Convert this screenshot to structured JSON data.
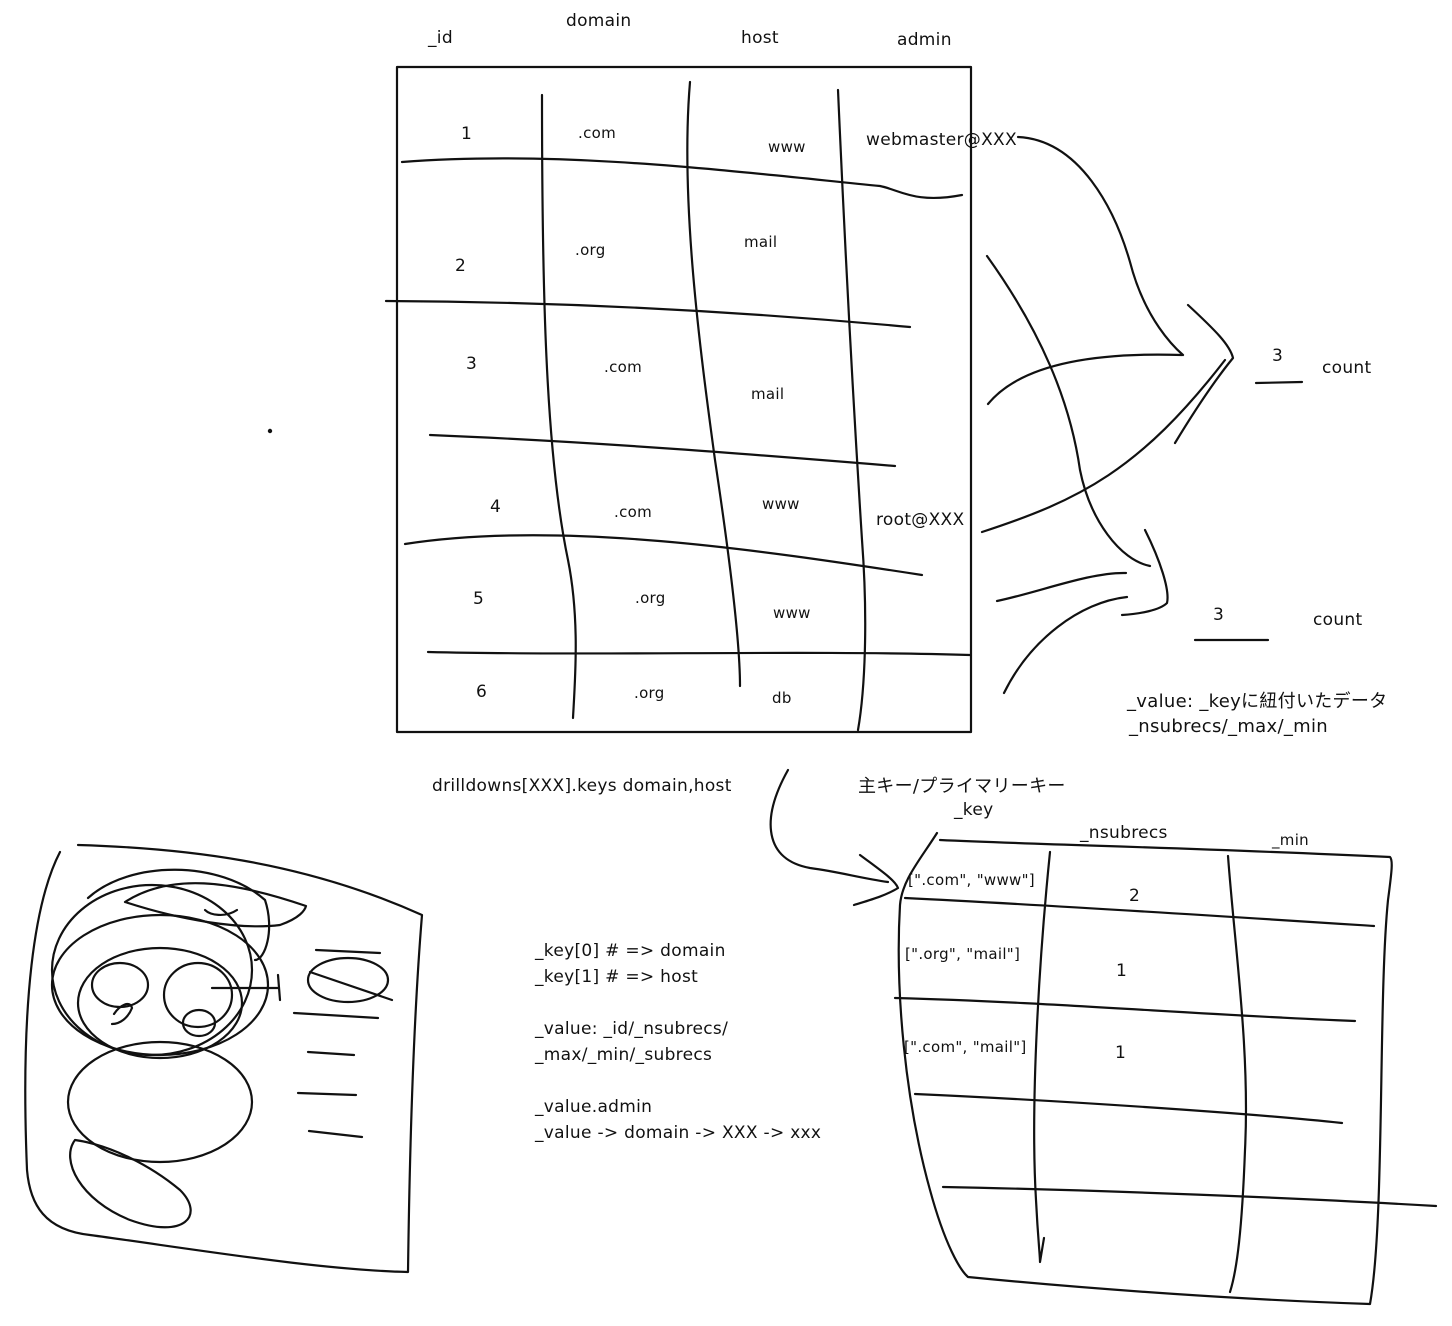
{
  "top_table": {
    "headers": {
      "id": "_id",
      "domain": "domain",
      "host": "host",
      "admin": "admin"
    },
    "rows": [
      {
        "id": "1",
        "domain": ".com",
        "host": "www",
        "admin": "webmaster@XXX"
      },
      {
        "id": "2",
        "domain": ".org",
        "host": "mail",
        "admin": ""
      },
      {
        "id": "3",
        "domain": ".com",
        "host": "mail",
        "admin": ""
      },
      {
        "id": "4",
        "domain": ".com",
        "host": "www",
        "admin": "root@XXX"
      },
      {
        "id": "5",
        "domain": ".org",
        "host": "www",
        "admin": ""
      },
      {
        "id": "6",
        "domain": ".org",
        "host": "db",
        "admin": ""
      }
    ]
  },
  "counts": [
    {
      "value": "3",
      "label": "count"
    },
    {
      "value": "3",
      "label": "count"
    }
  ],
  "value_note": {
    "line1": "_value: _keyに紐付いたデータ",
    "line2": "_nsubrecs/_max/_min"
  },
  "drilldown_label": "drilldowns[XXX].keys domain,host",
  "primary_key_label": "主キー/プライマリーキー",
  "result_table": {
    "key_header": "_key",
    "nsubrecs_header": "_nsubrecs",
    "min_header": "_min",
    "rows": [
      {
        "key": "[\".com\", \"www\"]",
        "nsubrecs": "2"
      },
      {
        "key": "[\".org\", \"mail\"]",
        "nsubrecs": "1"
      },
      {
        "key": "[\".com\", \"mail\"]",
        "nsubrecs": "1"
      }
    ]
  },
  "notes": [
    "_key[0] # => domain",
    "_key[1] # => host",
    "_value: _id/_nsubrecs/",
    "_max/_min/_subrecs",
    "_value.admin",
    "_value -> domain -> XXX -> xxx"
  ]
}
